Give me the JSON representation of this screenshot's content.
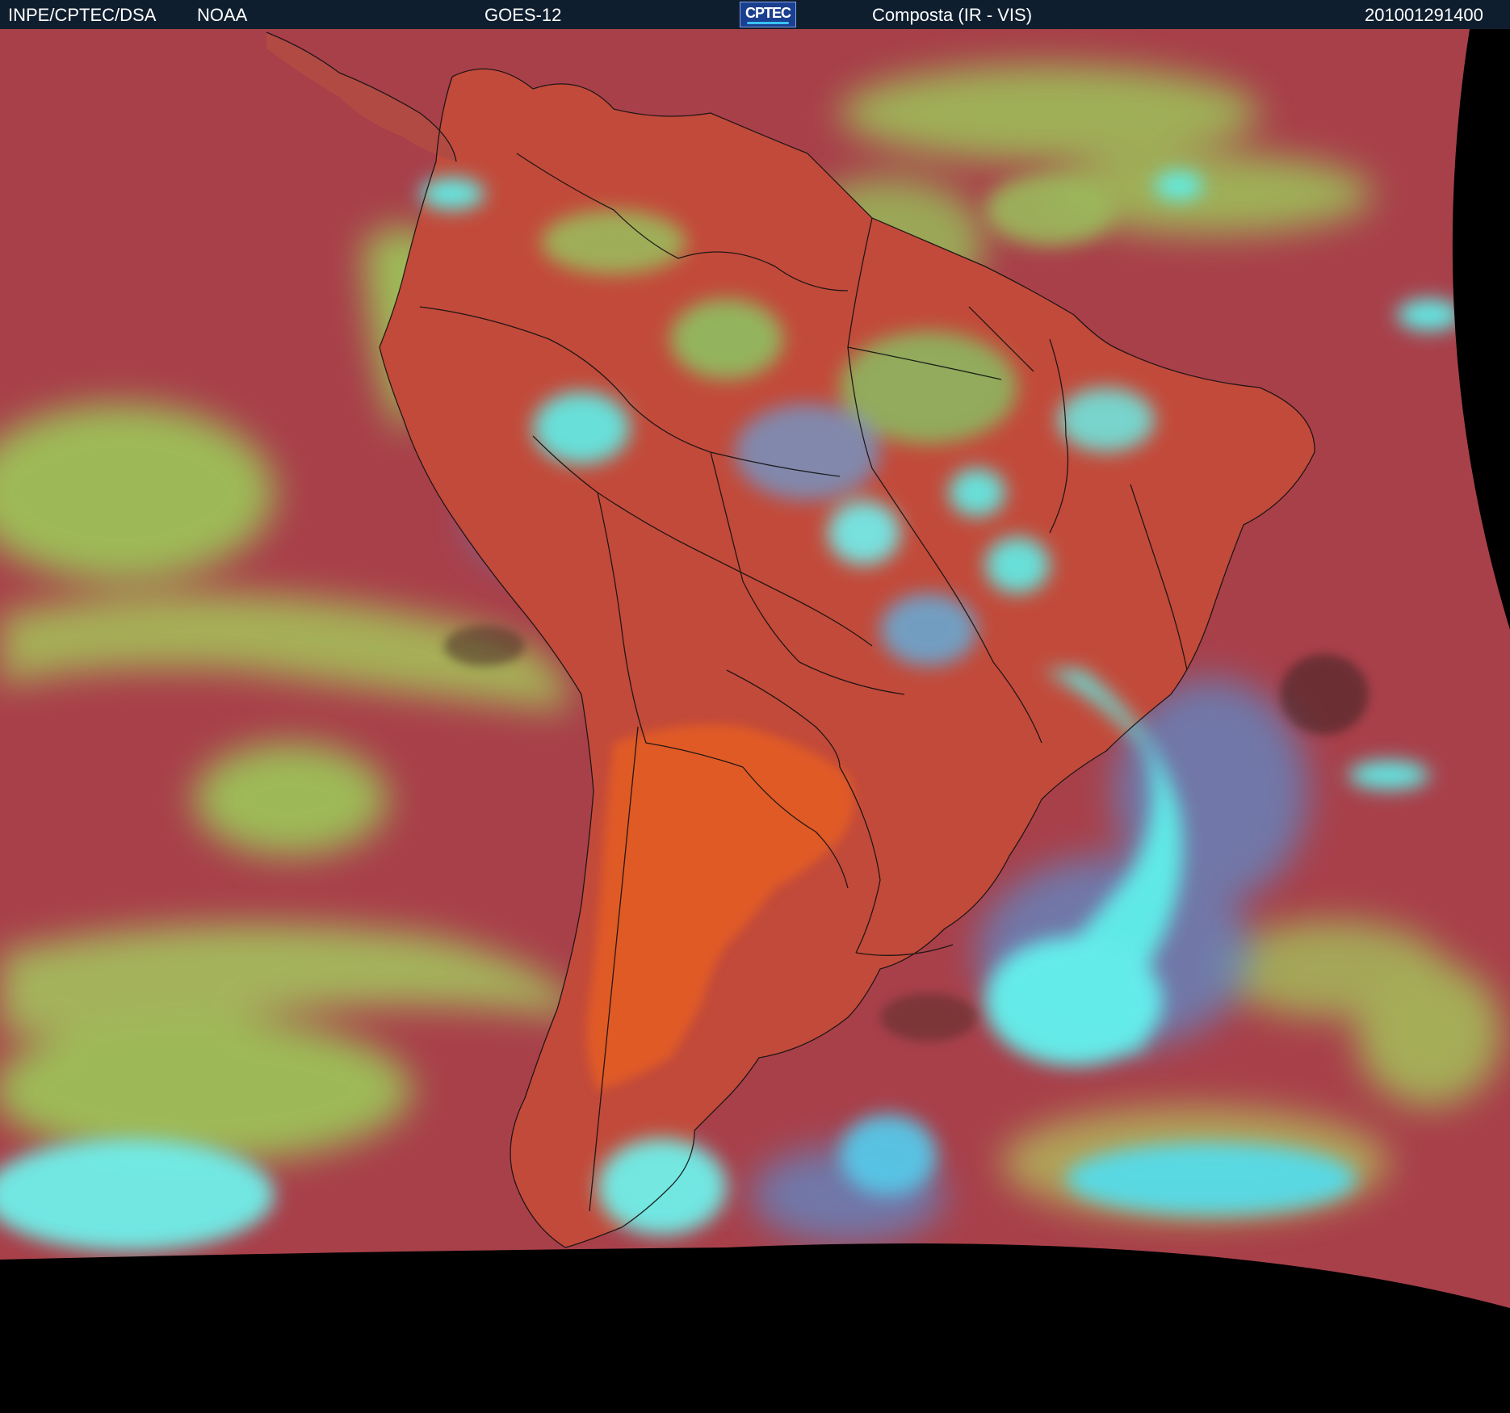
{
  "header": {
    "agency": "INPE/CPTEC/DSA",
    "provider": "NOAA",
    "satellite": "GOES-12",
    "logo_text": "CPTEC",
    "product": "Composta (IR - VIS)",
    "timestamp": "201001291400"
  },
  "colors": {
    "ocean_clear": "#a8404a",
    "land_clear": "#d4572f",
    "low_cloud": "#9ccf5a",
    "high_cloud": "#5ff0ea",
    "mid_cloud": "#5a8fd0",
    "space": "#000000",
    "border_lines": "#111111"
  }
}
